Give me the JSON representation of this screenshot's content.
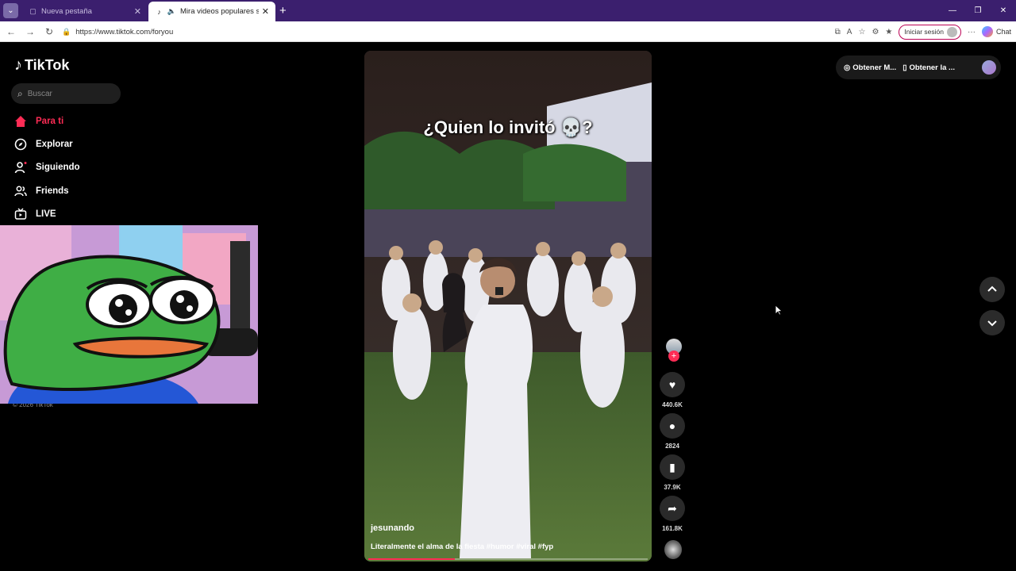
{
  "browser": {
    "tabs": [
      {
        "title": "Nueva pestaña",
        "active": false
      },
      {
        "title": "Mira videos populares seleccionados",
        "active": true
      }
    ],
    "url": "https://www.tiktok.com/foryou",
    "signin_label": "Iniciar sesión",
    "chat_label": "Chat"
  },
  "sidebar": {
    "logo": "TikTok",
    "search_placeholder": "Buscar",
    "items": [
      {
        "label": "Para ti",
        "icon": "home-icon",
        "active": true
      },
      {
        "label": "Explorar",
        "icon": "compass-icon",
        "active": false
      },
      {
        "label": "Siguiendo",
        "icon": "following-icon",
        "active": false
      },
      {
        "label": "Friends",
        "icon": "friends-icon",
        "active": false
      },
      {
        "label": "LIVE",
        "icon": "live-icon",
        "active": false
      }
    ],
    "copyright": "© 2026 TikTok"
  },
  "video": {
    "overlay_text": "¿Quien lo invitó 💀?",
    "author": "jesunando",
    "description": "Literalmente el alma de la fiesta #humor #viral #fyp",
    "progress": 0.31
  },
  "actions": {
    "likes": "440.6K",
    "comments": "2824",
    "saves": "37.9K",
    "shares": "161.8K"
  },
  "top_right": {
    "item1": "Obtener M...",
    "item2": "Obtener la ..."
  },
  "colors": {
    "accent": "#fe2c55",
    "tabbar": "#3b1f6e"
  }
}
